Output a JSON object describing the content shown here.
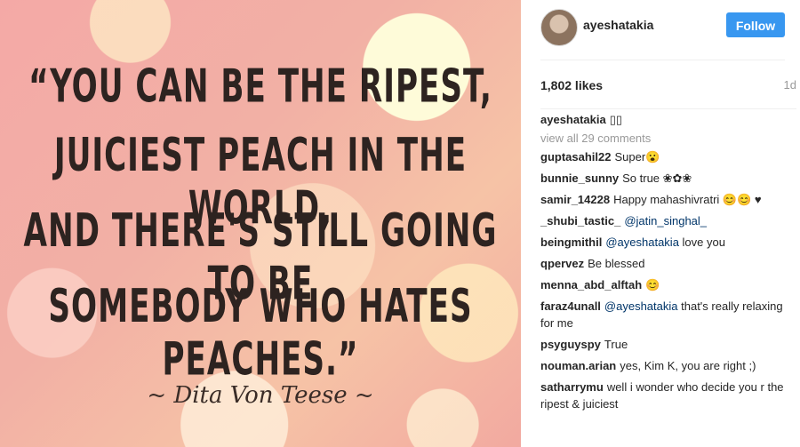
{
  "photo": {
    "quote_lines": [
      "“YOU CAN BE THE RIPEST,",
      "JUICIEST PEACH IN THE WORLD,",
      "AND THERE'S STILL GOING TO BE",
      "SOMEBODY WHO HATES PEACHES.”"
    ],
    "author": "~ Dita Von Teese ~"
  },
  "header": {
    "username": "ayeshatakia",
    "follow_label": "Follow"
  },
  "stats": {
    "likes": "1,802 likes",
    "time": "1d"
  },
  "caption": {
    "user": "ayeshatakia",
    "text": "▯▯"
  },
  "view_all": "view all 29 comments",
  "comments": [
    {
      "user": "guptasahil22",
      "text": "Super😮"
    },
    {
      "user": "bunnie_sunny",
      "text": "So true ❀✿❀"
    },
    {
      "user": "samir_14228",
      "text": "Happy mahashivratri 😊😊 ♥"
    },
    {
      "user": "_shubi_tastic_",
      "mention": "@jatin_singhal_",
      "text": ""
    },
    {
      "user": "beingmithil",
      "mention": "@ayeshatakia",
      "text": "love you"
    },
    {
      "user": "qpervez",
      "text": "Be blessed"
    },
    {
      "user": "menna_abd_alftah",
      "text": "😊"
    },
    {
      "user": "faraz4unall",
      "mention": "@ayeshatakia",
      "text": "that's really relaxing for me"
    },
    {
      "user": "psyguyspy",
      "text": "True"
    },
    {
      "user": "nouman.arian",
      "text": "yes, Kim K, you are right ;)"
    },
    {
      "user": "satharrymu",
      "text": "well i wonder who decide you r the ripest & juiciest"
    }
  ]
}
